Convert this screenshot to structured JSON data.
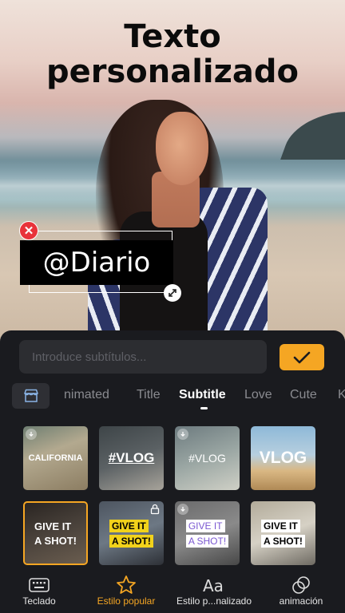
{
  "promo": {
    "title_line1": "Texto",
    "title_line2": "personalizado"
  },
  "sticker": {
    "text": "@Diario",
    "delete_icon": "close-icon",
    "resize_icon": "resize-icon"
  },
  "editor": {
    "input_placeholder": "Introduce subtítulos...",
    "input_value": "",
    "confirm_icon": "check-icon"
  },
  "tabs": {
    "store_icon": "store-icon",
    "items": [
      "nimated",
      "Title",
      "Subtitle",
      "Love",
      "Cute",
      "K"
    ],
    "active": "Subtitle"
  },
  "styles": [
    {
      "label": "CALIFORNIA",
      "downloadable": true
    },
    {
      "label": "#VLOG"
    },
    {
      "label": "#VLOG",
      "downloadable": true
    },
    {
      "label": "VLOG"
    },
    {
      "line1": "GIVE IT",
      "line2": "A SHOT!",
      "selected": true
    },
    {
      "line1": "GIVE IT",
      "line2": "A SHOT!",
      "locked": true
    },
    {
      "line1": "GIVE IT",
      "line2": "A SHOT!",
      "downloadable": true
    },
    {
      "line1": "GIVE IT",
      "line2": "A SHOT!"
    }
  ],
  "colors": {
    "accent": "#f5a623",
    "panel_bg": "#1a1b1f",
    "input_bg": "#2c2d31",
    "delete_red": "#e8323a"
  },
  "bottom_nav": {
    "items": [
      {
        "label": "Teclado",
        "icon": "keyboard-icon"
      },
      {
        "label": "Estilo popular",
        "icon": "star-icon",
        "active": true
      },
      {
        "label": "Estilo p...nalizado",
        "icon": "font-aa-icon"
      },
      {
        "label": "animación",
        "icon": "animation-icon"
      }
    ]
  }
}
